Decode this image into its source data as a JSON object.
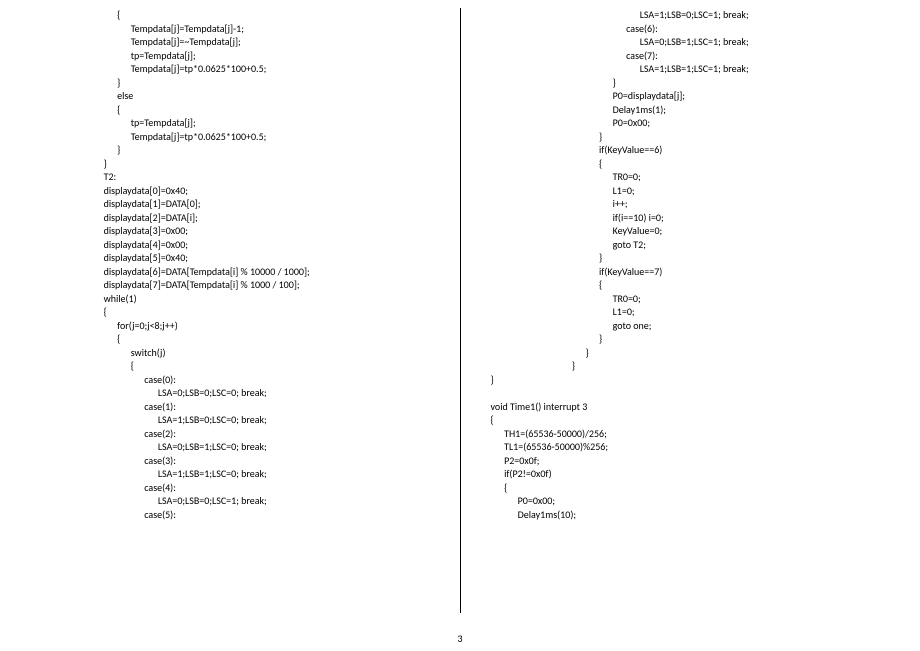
{
  "page_number": "3",
  "left_code": "            {\n                  Tempdata[j]=Tempdata[j]-1;\n                  Tempdata[j]=~Tempdata[j];\n                  tp=Tempdata[j];\n                  Tempdata[j]=tp*0.0625*100+0.5;\n            }\n            else\n            {\n                  tp=Tempdata[j];\n                  Tempdata[j]=tp*0.0625*100+0.5;\n            }\n      }\n      T2:\n      displaydata[0]=0x40;\n      displaydata[1]=DATA[0];\n      displaydata[2]=DATA[i];\n      displaydata[3]=0x00;\n      displaydata[4]=0x00;\n      displaydata[5]=0x40;\n      displaydata[6]=DATA[Tempdata[i] % 10000 / 1000];\n      displaydata[7]=DATA[Tempdata[i] % 1000 / 100];\n      while(1)\n      {\n            for(j=0;j<8;j++)\n            {\n                  switch(j)\n                  {\n                        case(0):\n                              LSA=0;LSB=0;LSC=0; break;\n                        case(1):\n                              LSA=1;LSB=0;LSC=0; break;\n                        case(2):\n                              LSA=0;LSB=1;LSC=0; break;\n                        case(3):\n                              LSA=1;LSB=1;LSC=0; break;\n                        case(4):\n                              LSA=0;LSB=0;LSC=1; break;\n                        case(5):",
  "right_code": "                                                                  LSA=1;LSB=0;LSC=1; break;\n                                                            case(6):\n                                                                  LSA=0;LSB=1;LSC=1; break;\n                                                            case(7):\n                                                                  LSA=1;LSB=1;LSC=1; break;\n                                                      }\n                                                      P0=displaydata[j];\n                                                      Delay1ms(1);\n                                                      P0=0x00;\n                                                }\n                                                if(KeyValue==6)\n                                                {\n                                                      TR0=0;\n                                                      L1=0;\n                                                      i++;\n                                                      if(i==10) i=0;\n                                                      KeyValue=0;\n                                                      goto T2;\n                                                }\n                                                if(KeyValue==7)\n                                                {\n                                                      TR0=0;\n                                                      L1=0;\n                                                      goto one;\n                                                }\n                                          }\n                                    }\n}\n\nvoid Time1() interrupt 3\n{\n      TH1=(65536-50000)/256;\n      TL1=(65536-50000)%256;\n      P2=0x0f;\n      if(P2!=0x0f)\n      {\n            P0=0x00;\n            Delay1ms(10);"
}
